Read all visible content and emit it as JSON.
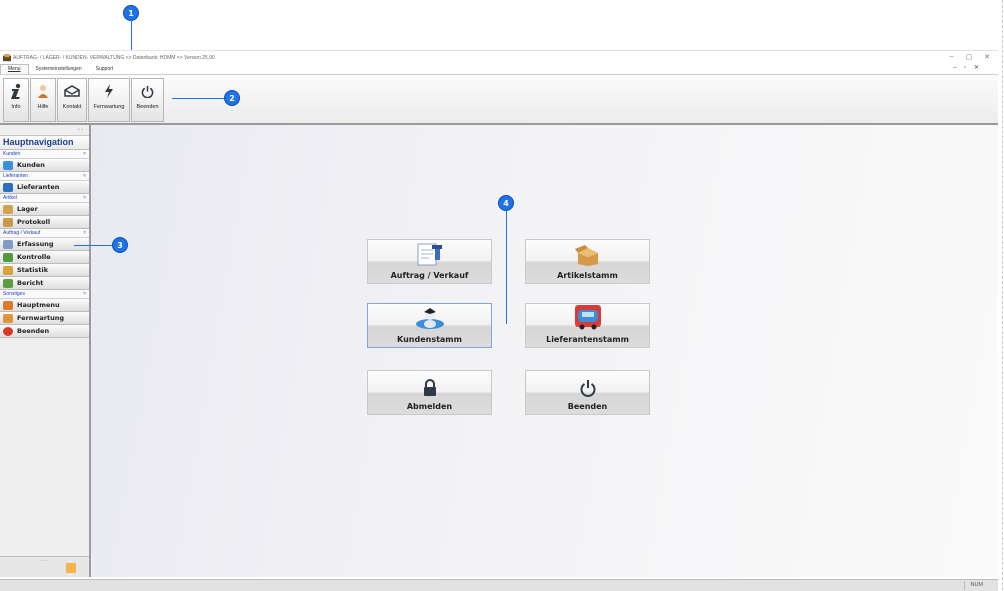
{
  "callouts": {
    "c1": "1",
    "c2": "2",
    "c3": "3",
    "c4": "4"
  },
  "window": {
    "title": "AUFTRAG- / LAGER- / KUNDEN- VERWALTUNG <> Datenbank: HDMM <> Version 25.90",
    "controls": {
      "minimize": "–",
      "restore": "▢",
      "close": "✕"
    }
  },
  "menubar": {
    "tabs": [
      {
        "label": "Menu"
      },
      {
        "label": "Systemeinstellungen"
      },
      {
        "label": "Support"
      }
    ],
    "mdi_controls": "– ▫ ✕"
  },
  "ribbon": {
    "buttons": [
      {
        "label": "Info",
        "icon": "info-icon"
      },
      {
        "label": "Hilfe",
        "icon": "help-person-icon"
      },
      {
        "label": "Kontakt",
        "icon": "envelope-icon"
      },
      {
        "label": "Fernwartung",
        "icon": "lightning-icon"
      },
      {
        "label": "Beenden",
        "icon": "power-icon"
      }
    ]
  },
  "sidebar": {
    "pin": "‹ ‹",
    "title": "Hauptnavigation",
    "collapse_glyph": "≈",
    "groups": [
      {
        "label": "Kunden",
        "items": [
          {
            "label": "Kunden",
            "icon": "customers-icon",
            "color": "#3a8fd8"
          }
        ]
      },
      {
        "label": "Lieferanten",
        "items": [
          {
            "label": "Lieferanten",
            "icon": "supplier-icon",
            "color": "#2e6fc2"
          }
        ]
      },
      {
        "label": "Artikel",
        "items": [
          {
            "label": "Lager",
            "icon": "box-icon",
            "color": "#d4a24c"
          },
          {
            "label": "Protokoll",
            "icon": "box-icon",
            "color": "#c99a48"
          }
        ]
      },
      {
        "label": "Auftrag / Verkauf",
        "items": [
          {
            "label": "Erfassung",
            "icon": "form-icon",
            "color": "#7f9bc4"
          },
          {
            "label": "Kontrolle",
            "icon": "check-chart-icon",
            "color": "#4e9a3c"
          },
          {
            "label": "Statistik",
            "icon": "folder-chart-icon",
            "color": "#d8a23c"
          },
          {
            "label": "Bericht",
            "icon": "report-icon",
            "color": "#5a9f46"
          }
        ]
      },
      {
        "label": "Sonstiges",
        "items": [
          {
            "label": "Hauptmenu",
            "icon": "menu-icon",
            "color": "#e07a2a"
          },
          {
            "label": "Fernwartung",
            "icon": "person-icon",
            "color": "#d9963c"
          },
          {
            "label": "Beenden",
            "icon": "exit-icon",
            "color": "#d83a2a"
          }
        ]
      }
    ],
    "footer_dots": "......"
  },
  "tiles": [
    {
      "label": "Auftrag / Verkauf",
      "icon": "order-form-icon"
    },
    {
      "label": "Artikelstamm",
      "icon": "open-box-icon"
    },
    {
      "label": "Kundenstamm",
      "icon": "customers-icon"
    },
    {
      "label": "Lieferantenstamm",
      "icon": "supplier-icon"
    },
    {
      "label": "Abmelden",
      "icon": "lock-icon"
    },
    {
      "label": "Beenden",
      "icon": "power-icon"
    }
  ],
  "statusbar": {
    "num": "NUM"
  }
}
